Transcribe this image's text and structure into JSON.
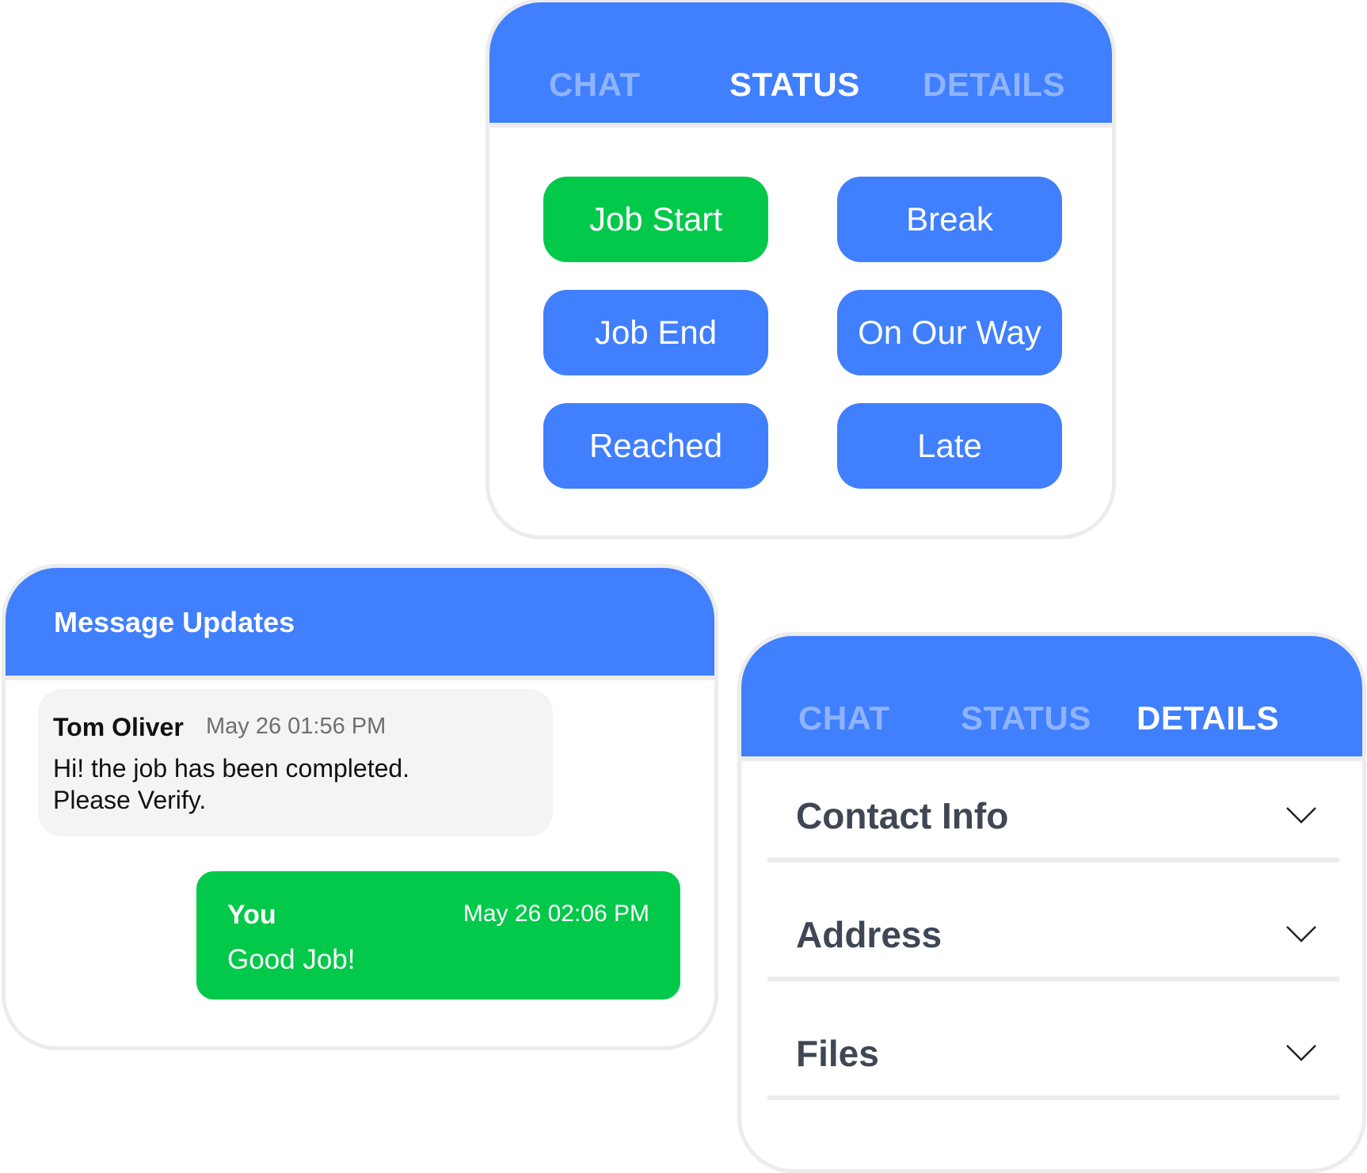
{
  "status_card": {
    "tabs": [
      {
        "label": "CHAT",
        "active": false
      },
      {
        "label": "STATUS",
        "active": true
      },
      {
        "label": "DETAILS",
        "active": false
      }
    ],
    "buttons": [
      {
        "label": "Job Start",
        "color": "#02c94a"
      },
      {
        "label": "Break",
        "color": "#407ffd"
      },
      {
        "label": "Job End",
        "color": "#407ffd"
      },
      {
        "label": "On Our Way",
        "color": "#407ffd"
      },
      {
        "label": "Reached",
        "color": "#407ffd"
      },
      {
        "label": "Late",
        "color": "#407ffd"
      }
    ]
  },
  "message_card": {
    "title": "Message Updates",
    "incoming": {
      "sender": "Tom Oliver",
      "time": "May 26 01:56 PM",
      "line1": "Hi! the job has been completed.",
      "line2": "Please Verify."
    },
    "outgoing": {
      "sender": "You",
      "time": "May 26 02:06 PM",
      "text": "Good Job!"
    }
  },
  "details_card": {
    "tabs": [
      {
        "label": "CHAT",
        "active": false
      },
      {
        "label": "STATUS",
        "active": false
      },
      {
        "label": "DETAILS",
        "active": true
      }
    ],
    "sections": [
      {
        "label": "Contact Info",
        "icon": "chevron-down-icon"
      },
      {
        "label": "Address",
        "icon": "chevron-down-icon"
      },
      {
        "label": "Files",
        "icon": "chevron-down-icon"
      }
    ]
  },
  "colors": {
    "primary": "#407ffd",
    "success": "#02c94a",
    "tab_inactive": "#8fb4ff",
    "border": "#ececec",
    "bubble_bg": "#f3f4f6"
  }
}
